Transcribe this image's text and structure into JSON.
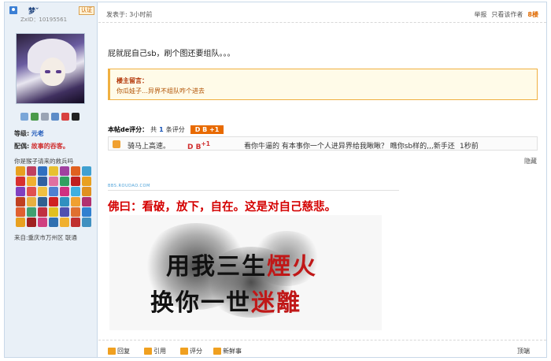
{
  "sidebar": {
    "username": "梦ˇ",
    "user_id": "ZxID：10195561",
    "verify_label": "认证",
    "level_label": "等级:",
    "level_value": "元老",
    "match_label": "配偶:",
    "match_value": "故事的吞客。",
    "motto": "你是猴子请来的救兵吗",
    "from": "来自:重庆市万州区 联通"
  },
  "post": {
    "time": "发表于: 3小时前",
    "report": "举报",
    "only_author": "只看该作者",
    "floor": "8楼",
    "content": "屁就屁自己sb，刷个图还要组队。。。",
    "quote_title": "楼主留言：",
    "quote_body": "你瓜娃子…异界不组队咋个进去"
  },
  "rating": {
    "title": "本帖de评分：",
    "count_prefix": "共",
    "count": "1",
    "count_suffix": "条评分",
    "badge": "D B +1",
    "user": "骑马上高速。",
    "score": "D B",
    "score_sup": "+1",
    "reason": "看你牛逼的 有本事你一个人进异界给我瞅瞅？ 瞧你sb样的,,,新手还",
    "time": "1秒前",
    "hide": "隐藏"
  },
  "signature": {
    "site_mark": "BBS.ROUDAO.COM",
    "text": "佛曰：看破，放下，自在。这是对自己慈悲。",
    "img_line1_a": "用我三生",
    "img_line1_b": "煙火",
    "img_line2_a": "换你一世",
    "img_line2_b": "迷離"
  },
  "footer": {
    "reply": "回复",
    "quote": "引用",
    "rate": "评分",
    "fresh": "新鲜事",
    "top": "顶端"
  },
  "icons": [
    "user-icon",
    "mail-icon",
    "add-friend-icon",
    "profile-icon",
    "album-icon",
    "wall-icon",
    "qq-icon",
    "rate-icon",
    "reply-icon",
    "quote-icon",
    "fresh-icon"
  ]
}
